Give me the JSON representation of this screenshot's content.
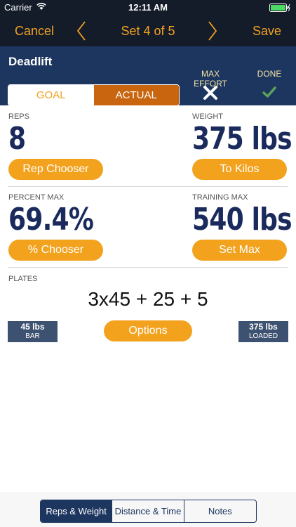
{
  "status": {
    "carrier": "Carrier",
    "time": "12:11 AM"
  },
  "nav": {
    "cancel_label": "Cancel",
    "title": "Set 4 of 5",
    "save_label": "Save"
  },
  "exercise": {
    "name": "Deadlift",
    "max_effort_label": "MAX EFFORT",
    "done_label": "DONE",
    "segments": {
      "goal": "GOAL",
      "actual": "ACTUAL",
      "selected": "ACTUAL"
    }
  },
  "reps": {
    "label": "REPS",
    "value": "8",
    "button": "Rep Chooser"
  },
  "weight": {
    "label": "WEIGHT",
    "value": "375 lbs",
    "button": "To Kilos"
  },
  "percent_max": {
    "label": "PERCENT MAX",
    "value": "69.4%",
    "button": "% Chooser"
  },
  "training_max": {
    "label": "TRAINING MAX",
    "value": "540 lbs",
    "button": "Set Max"
  },
  "plates": {
    "label": "PLATES",
    "value": "3x45 + 25 + 5",
    "bar": {
      "value": "45 lbs",
      "caption": "BAR"
    },
    "loaded": {
      "value": "375 lbs",
      "caption": "LOADED"
    },
    "options_button": "Options"
  },
  "bottom_tabs": {
    "items": [
      "Reps & Weight",
      "Distance & Time",
      "Notes"
    ],
    "selected": "Reps & Weight"
  },
  "colors": {
    "nav_bg": "#141c2a",
    "header_bg": "#1d3660",
    "accent_orange": "#f3a21e",
    "actual_orange": "#c9650f",
    "value_navy": "#1a2a5c",
    "done_green": "#5aa35a"
  }
}
